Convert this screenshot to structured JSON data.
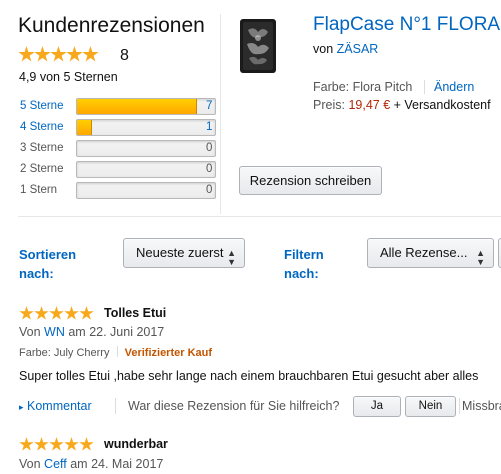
{
  "summary": {
    "heading": "Kundenrezensionen",
    "total_reviews": "8",
    "rating_text": "4,9 von 5 Sternen",
    "histogram": [
      {
        "label": "5 Sterne",
        "count": "7",
        "fraction": 0.86,
        "linked": true
      },
      {
        "label": "4 Sterne",
        "count": "1",
        "fraction": 0.1,
        "linked": true
      },
      {
        "label": "3 Sterne",
        "count": "0",
        "fraction": 0,
        "linked": false
      },
      {
        "label": "2 Sterne",
        "count": "0",
        "fraction": 0,
        "linked": false
      },
      {
        "label": "1 Stern",
        "count": "0",
        "fraction": 0,
        "linked": false
      }
    ],
    "write_review_label": "Rezension schreiben"
  },
  "product": {
    "title": "FlapCase N°1 FLORA",
    "by_prefix": "von",
    "brand": "ZÄSAR",
    "color_label": "Farbe: Flora Pitch",
    "change_link": "Ändern",
    "price_prefix": "Preis:",
    "price": "19,47 €",
    "shipping": "+ Versandkostenf",
    "image_icon": "phone-case-image"
  },
  "filters": {
    "sort_label_1": "Sortieren",
    "sort_label_2": "nach:",
    "sort_value": "Neueste zuerst",
    "filter_label_1": "Filtern",
    "filter_label_2": "nach:",
    "filter_value": "Alle Rezense..."
  },
  "reviews": [
    {
      "title": "Tolles Etui",
      "by_prefix": "Von",
      "author": "WN",
      "date": "am 22. Juni 2017",
      "variant": "Farbe: July Cherry",
      "verified": "Verifizierter Kauf",
      "body": "Super tolles Etui ,habe sehr lange nach einem brauchbaren Etui gesucht aber alles",
      "comment_link": "Kommentar",
      "helpful_question": "War diese Rezension für Sie hilfreich?",
      "yes_label": "Ja",
      "no_label": "Nein",
      "abuse_label": "Missbra"
    },
    {
      "title": "wunderbar",
      "by_prefix": "Von",
      "author": "Ceff",
      "date": "am 24. Mai 2017"
    }
  ],
  "colors": {
    "link": "#0066c0",
    "star": "#f7a81b",
    "price": "#b12704",
    "verified": "#c45500"
  }
}
